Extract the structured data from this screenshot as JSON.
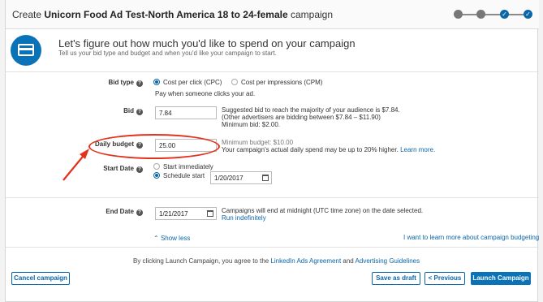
{
  "header": {
    "prefix": "Create ",
    "campaign_name": "Unicorn Food Ad Test-North America 18 to 24-female",
    "suffix": " campaign",
    "check": "✓"
  },
  "intro": {
    "heading": "Let's figure out how much you'd like to spend on your campaign",
    "subtext": "Tell us your bid type and budget and when you'd like your campaign to start."
  },
  "bid_type": {
    "label": "Bid type",
    "option_cpc": "Cost per click (CPC)",
    "option_cpm": "Cost per impressions (CPM)",
    "note": "Pay when someone clicks your ad."
  },
  "bid": {
    "label": "Bid",
    "value": "7.84",
    "suggest_1": "Suggested bid to reach the majority of your audience is $7.84.",
    "suggest_2": "(Other advertisers are bidding between $7.84 – $11.90)",
    "minimum": "Minimum bid: $2.00."
  },
  "budget": {
    "label": "Daily budget",
    "value": "25.00",
    "minimum": "Minimum budget: $10.00",
    "note": "Your campaign's actual daily spend may be up to 20% higher.",
    "learn_more": "Learn more."
  },
  "start": {
    "label": "Start Date",
    "option_immediate": "Start immediately",
    "option_schedule": "Schedule start",
    "date": "1/20/2017"
  },
  "end": {
    "label": "End Date",
    "date": "1/21/2017",
    "note": "Campaigns will end at midnight (UTC time zone) on the date selected.",
    "run_indefinitely": "Run indefinitely"
  },
  "links": {
    "show_less": "Show less",
    "learn_budgeting": "I want to learn more about campaign budgeting"
  },
  "agreement": {
    "prefix": "By clicking Launch Campaign, you agree to the ",
    "ads_agreement": "LinkedIn Ads Agreement",
    "and": " and ",
    "guidelines": "Advertising Guidelines"
  },
  "buttons": {
    "cancel": "Cancel campaign",
    "save_draft": "Save as draft",
    "previous": "< Previous",
    "launch": "Launch Campaign"
  },
  "icons": {
    "help": "?",
    "chevron_up": "⌃"
  },
  "colors": {
    "accent": "#0a73b7",
    "annotation": "#e2311d"
  }
}
